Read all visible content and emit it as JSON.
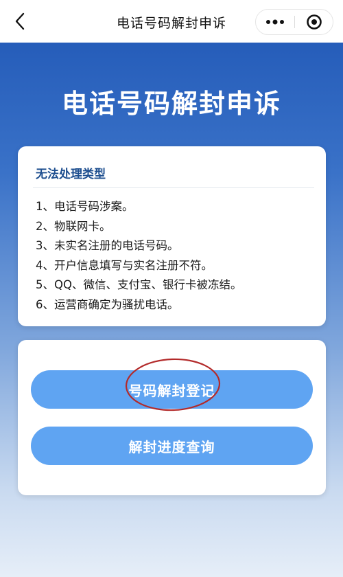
{
  "navbar": {
    "title": "电话号码解封申诉",
    "back_icon": "chevron-left-icon",
    "more_icon": "more-dots-icon",
    "close_icon": "target-circle-icon"
  },
  "hero": {
    "title": "电话号码解封申诉"
  },
  "info_card": {
    "title": "无法处理类型",
    "items": [
      "1、电话号码涉案。",
      "2、物联网卡。",
      "3、未实名注册的电话号码。",
      "4、开户信息填写与实名注册不符。",
      "5、QQ、微信、支付宝、银行卡被冻结。",
      "6、运营商确定为骚扰电话。"
    ]
  },
  "actions": {
    "register_label": "号码解封登记",
    "query_label": "解封进度查询"
  },
  "colors": {
    "title_blue": "#1d4e8f",
    "button_blue": "#5fa4f2",
    "annotation_red": "#b32a2a"
  }
}
